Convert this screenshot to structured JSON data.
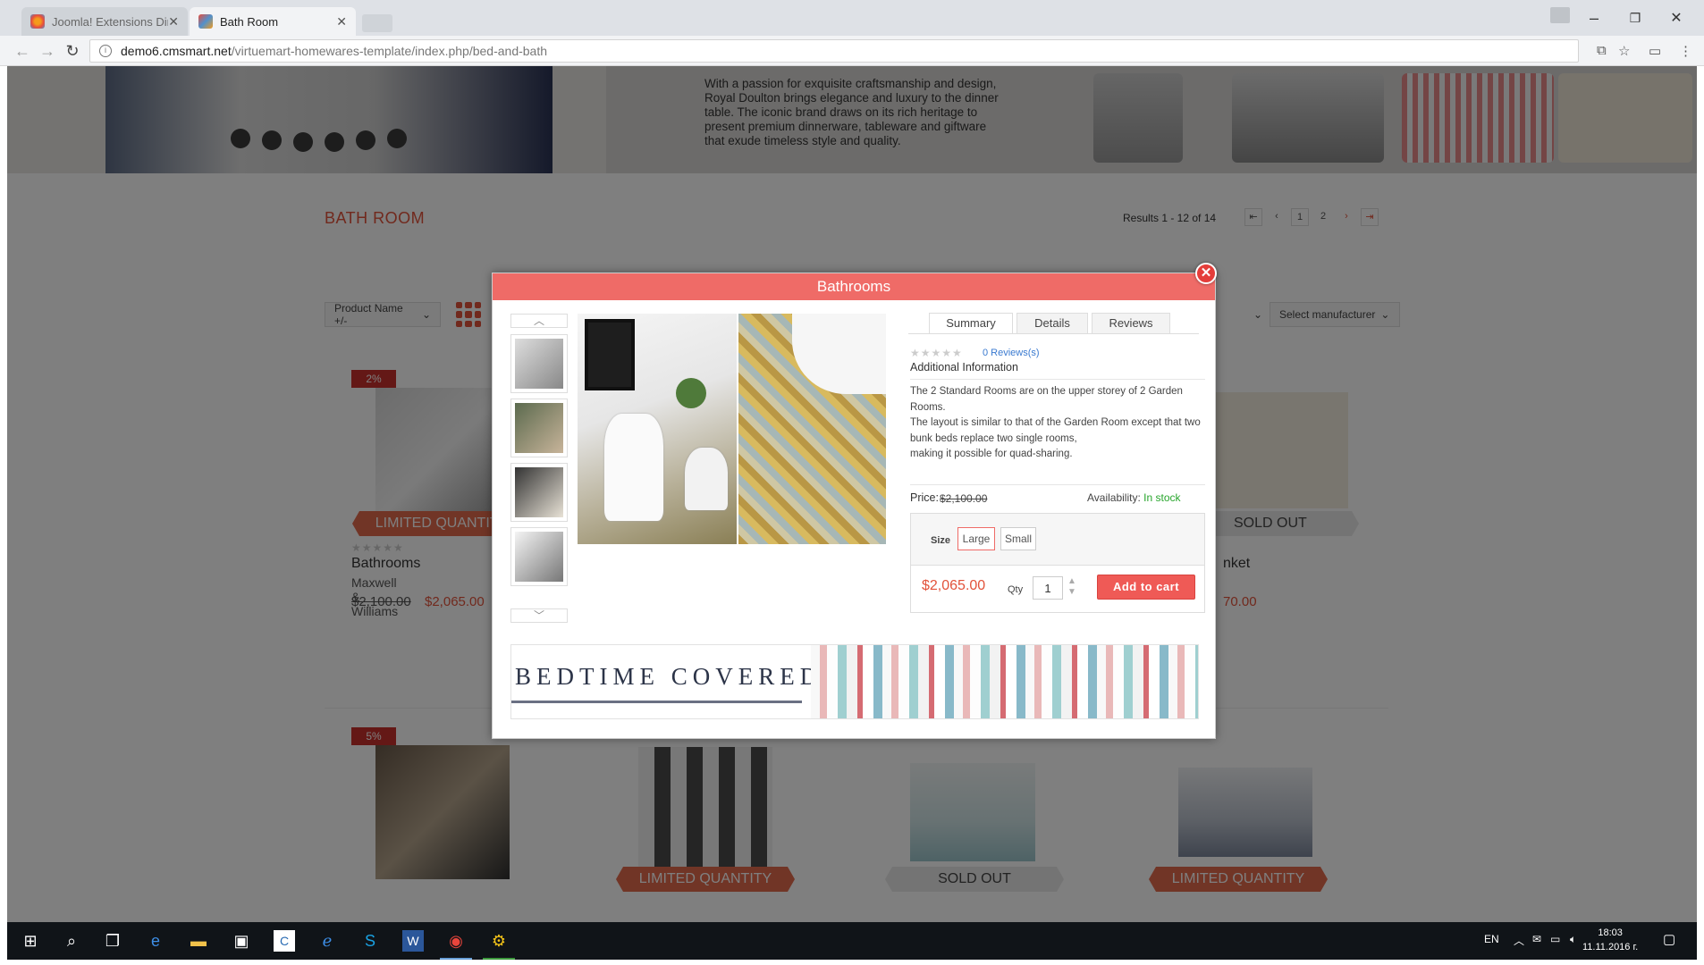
{
  "browser": {
    "tabs": [
      {
        "title": "Joomla! Extensions Direc"
      },
      {
        "title": "Bath Room"
      }
    ],
    "url_domain": "demo6.cmsmart.net",
    "url_path": "/virtuemart-homewares-template/index.php/bed-and-bath",
    "controls": {
      "minimize": "–",
      "restore": "❐",
      "close": "✕"
    }
  },
  "page": {
    "hero_text": "With a passion for exquisite craftsmanship and design, Royal Doulton brings elegance and luxury to the dinner table. The iconic brand draws on its rich heritage to present premium dinnerware, tableware and giftware that exude timeless style and quality.",
    "section_title": "BATH ROOM",
    "results": "Results 1 - 12 of 14",
    "pager": {
      "first": "⇤",
      "prev": "‹",
      "p1": "1",
      "p2": "2",
      "next": "›",
      "last": "⇥"
    },
    "sort_label": "Product Name +/-",
    "manufacturer_label": "Select manufacturer",
    "products": [
      {
        "badge": "2%",
        "ribbon": "LIMITED QUANTITY",
        "name": "Bathrooms",
        "brand": "Maxwell & Williams",
        "old_price": "$2,100.00",
        "new_price": "$2,065.00"
      },
      {
        "ribbon": "SOLD OUT",
        "name": "nket",
        "new_price": "70.00"
      },
      {
        "badge": "5%"
      },
      {
        "ribbon": "LIMITED QUANTITY"
      },
      {
        "ribbon": "SOLD OUT"
      },
      {
        "ribbon": "LIMITED QUANTITY"
      }
    ]
  },
  "modal": {
    "title": "Bathrooms",
    "close": "✕",
    "tabs": [
      "Summary",
      "Details",
      "Reviews"
    ],
    "stars": "★★★★★",
    "reviews_link": "0 Reviews(s)",
    "additional_info": "Additional Information",
    "description": [
      "The 2 Standard Rooms are on the upper storey of 2 Garden Rooms.",
      "The layout is similar to that of the Garden Room except that two bunk beds replace two single rooms,",
      "making it possible for quad-sharing."
    ],
    "price_label": "Price:",
    "price_old": "$2,100.00",
    "availability_label": "Availability:",
    "availability_value": "In stock",
    "size_label": "Size",
    "sizes": [
      "Large",
      "Small"
    ],
    "final_price": "$2,065.00",
    "qty_label": "Qty",
    "qty_value": "1",
    "add_to_cart": "Add to cart",
    "banner_title": "BEDTIME COVERED",
    "thumb_up": "︿",
    "thumb_down": "﹀"
  },
  "taskbar": {
    "lang": "EN",
    "time": "18:03",
    "date": "11.11.2016 г."
  }
}
